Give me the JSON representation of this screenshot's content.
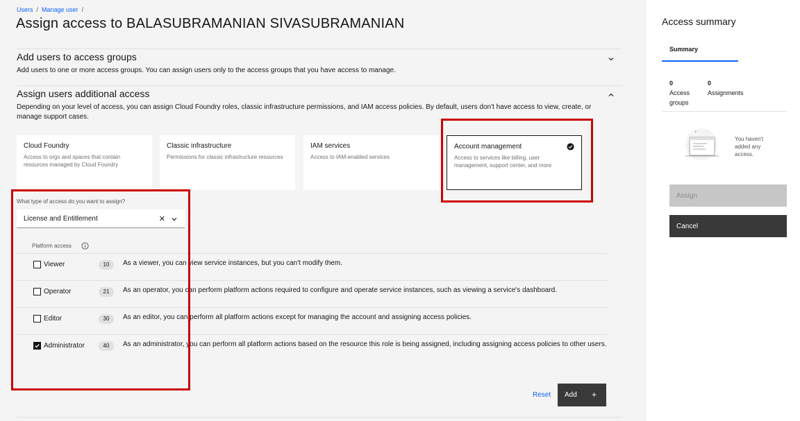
{
  "breadcrumb": {
    "items": [
      "Users",
      "Manage user"
    ],
    "sep": "/"
  },
  "page": {
    "title": "Assign access to BALASUBRAMANIAN SIVASUBRAMANIAN"
  },
  "sections": {
    "groups": {
      "title": "Add users to access groups",
      "desc": "Add users to one or more access groups. You can assign users only to the access groups that you have access to manage."
    },
    "additional": {
      "title": "Assign users additional access",
      "desc": "Depending on your level of access, you can assign Cloud Foundry roles, classic infrastructure permissions, and IAM access policies. By default, users don't have access to view, create, or manage support cases."
    }
  },
  "tiles": [
    {
      "title": "Cloud Foundry",
      "desc": "Access to orgs and spaces that contain resources managed by Cloud Foundry"
    },
    {
      "title": "Classic infrastructure",
      "desc": "Permissions for classic infrastructure resources"
    },
    {
      "title": "IAM services",
      "desc": "Access to IAM-enabled services"
    },
    {
      "title": "Account management",
      "desc": "Access to services like billing, user management, support center, and more"
    }
  ],
  "access_type": {
    "label": "What type of access do you want to assign?",
    "value": "License and Entitlement"
  },
  "platform_access": {
    "header": "Platform access",
    "roles": [
      {
        "name": "Viewer",
        "count": "10",
        "desc": "As a viewer, you can view service instances, but you can't modify them.",
        "checked": false
      },
      {
        "name": "Operator",
        "count": "21",
        "desc": "As an operator, you can perform platform actions required to configure and operate service instances, such as viewing a service's dashboard.",
        "checked": false
      },
      {
        "name": "Editor",
        "count": "30",
        "desc": "As an editor, you can perform all platform actions except for managing the account and assigning access policies.",
        "checked": false
      },
      {
        "name": "Administrator",
        "count": "40",
        "desc": "As an administrator, you can perform all platform actions based on the resource this role is being assigned, including assigning access policies to other users.",
        "checked": true
      }
    ]
  },
  "actions": {
    "reset": "Reset",
    "add": "Add",
    "add_icon": "+"
  },
  "summary": {
    "title": "Access summary",
    "tab": "Summary",
    "groups_count": "0",
    "groups_label_1": "Access",
    "groups_label_2": "groups",
    "assignments_count": "0",
    "assignments_label": "Assignments",
    "empty": "You haven't added any access.",
    "assign": "Assign",
    "cancel": "Cancel"
  },
  "colors": {
    "accent": "#0f62fe",
    "highlight": "#cc0000",
    "dark_button": "#393939"
  }
}
